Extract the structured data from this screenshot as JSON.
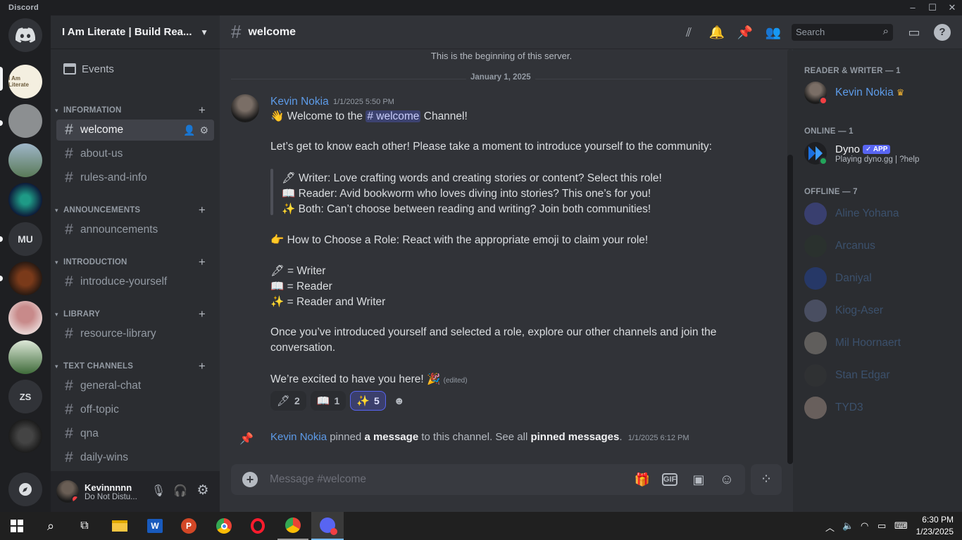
{
  "window": {
    "brand": "Discord"
  },
  "guild": {
    "name": "I Am Literate | Build Rea...",
    "events_label": "Events"
  },
  "servers": [
    {
      "label": "",
      "color": "#f4efe0"
    },
    {
      "label": "",
      "color": "#8c8f91"
    },
    {
      "label": "",
      "color": "#5a7a58"
    },
    {
      "label": "",
      "color": "#0d1b3a"
    },
    {
      "label": "MU",
      "color": "#313338"
    },
    {
      "label": "",
      "color": "#2a1a12"
    },
    {
      "label": "",
      "color": "#c88a8a"
    },
    {
      "label": "",
      "color": "#3f6b3a"
    },
    {
      "label": "ZS",
      "color": "#313338"
    },
    {
      "label": "",
      "color": "#1c1c1c"
    }
  ],
  "categories": [
    {
      "name": "INFORMATION",
      "channels": [
        "welcome",
        "about-us",
        "rules-and-info"
      ]
    },
    {
      "name": "ANNOUNCEMENTS",
      "channels": [
        "announcements"
      ]
    },
    {
      "name": "INTRODUCTION",
      "channels": [
        "introduce-yourself"
      ]
    },
    {
      "name": "LIBRARY",
      "channels": [
        "resource-library"
      ]
    },
    {
      "name": "TEXT CHANNELS",
      "channels": [
        "general-chat",
        "off-topic",
        "qna",
        "daily-wins"
      ]
    }
  ],
  "user": {
    "name": "Kevinnnnn",
    "status": "Do Not Distu..."
  },
  "channel": {
    "name": "welcome"
  },
  "header": {
    "search_placeholder": "Search"
  },
  "chat": {
    "beginning": "This is the beginning of this server.",
    "date_divider": "January 1, 2025",
    "message": {
      "author": "Kevin Nokia",
      "timestamp": "1/1/2025 5:50 PM",
      "line1_pre": "Welcome to the",
      "line1_mention": "# welcome",
      "line1_post": "Channel!",
      "line2": "Let’s get to know each other! Please take a moment to introduce yourself to the community:",
      "q1": "Writer: Love crafting words and creating stories or content? Select this role!",
      "q2": "Reader: Avid bookworm who loves diving into stories? This one’s for you!",
      "q3": "Both: Can’t choose between reading and writing? Join both communities!",
      "how": "How to Choose a Role: React with the appropriate emoji to claim your role!",
      "r1": "= Writer",
      "r2": "= Reader",
      "r3": "= Reader and Writer",
      "once1": "Once you’ve introduced yourself and selected a role, explore our other channels and join the",
      "once2": "conversation.",
      "excited": "We’re excited to have you here!",
      "edited": "(edited)"
    },
    "reactions": [
      {
        "emoji": "🖋",
        "count": "2",
        "me": false
      },
      {
        "emoji": "📖",
        "count": "1",
        "me": false
      },
      {
        "emoji": "✨",
        "count": "5",
        "me": true
      }
    ],
    "pin": {
      "user": "Kevin Nokia",
      "t1": "pinned",
      "b1": "a message",
      "t2": "to this channel. See all",
      "b2": "pinned messages",
      "t3": ".",
      "ts": "1/1/2025 6:12 PM"
    },
    "composer_placeholder": "Message #welcome"
  },
  "members": {
    "group1": "READER & WRITER — 1",
    "kevin": "Kevin Nokia",
    "group2": "ONLINE — 1",
    "dyno": "Dyno",
    "dyno_badge": "✓ APP",
    "dyno_activity": "Playing dyno.gg | ?help",
    "group3": "OFFLINE — 7",
    "offline": [
      "Aline Yohana",
      "Arcanus",
      "Daniyal",
      "Kiog-Aser",
      "Mil Hoornaert",
      "Stan Edgar",
      "TYD3"
    ]
  },
  "taskbar": {
    "time": "6:30 PM",
    "date": "1/23/2025"
  },
  "colors": {
    "accent": "#5865f2",
    "link": "#5d9be8",
    "dnd": "#f23f43",
    "online": "#23a55a"
  }
}
